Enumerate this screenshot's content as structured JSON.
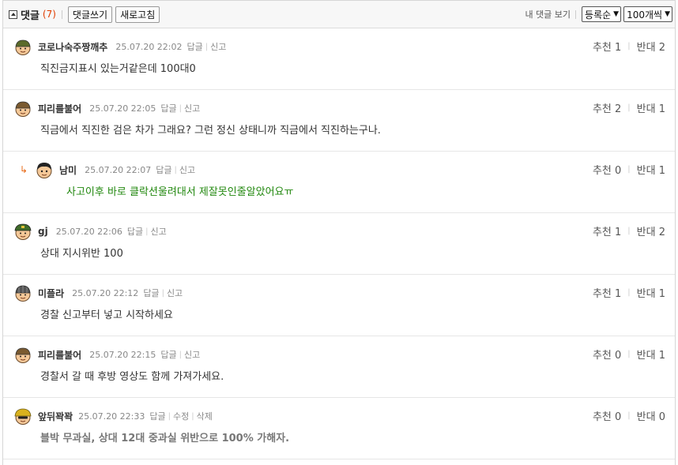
{
  "header": {
    "title": "댓글",
    "count": "(7)",
    "write_button": "댓글쓰기",
    "refresh_button": "새로고침",
    "my_comments_link": "내 댓글 보기",
    "sort_select": "등록순",
    "per_page_select": "100개씩"
  },
  "comments": [
    {
      "nick": "코로나숙주짱깨추",
      "date": "25.07.20 22:02",
      "act1": "답글",
      "act2": "신고",
      "text": "직진금지표시 있는거같은데 100대0",
      "up_label": "추천",
      "up": "1",
      "down_label": "반대",
      "down": "2"
    },
    {
      "nick": "피리를불어",
      "date": "25.07.20 22:05",
      "act1": "답글",
      "act2": "신고",
      "text": "직금에서 직진한 검은 차가 그래요? 그런 정신 상태니까 직금에서 직진하는구나.",
      "up_label": "추천",
      "up": "2",
      "down_label": "반대",
      "down": "1"
    },
    {
      "nick": "남미",
      "date": "25.07.20 22:07",
      "act1": "답글",
      "act2": "신고",
      "text": "사고이후 바로 클락션울려대서 제잘못인줄알았어요ㅠ",
      "up_label": "추천",
      "up": "0",
      "down_label": "반대",
      "down": "1",
      "reply_icon": "↳"
    },
    {
      "nick": "gj",
      "date": "25.07.20 22:06",
      "act1": "답글",
      "act2": "신고",
      "text": "상대 지시위반 100",
      "up_label": "추천",
      "up": "1",
      "down_label": "반대",
      "down": "2"
    },
    {
      "nick": "미플라",
      "date": "25.07.20 22:12",
      "act1": "답글",
      "act2": "신고",
      "text": "경찰 신고부터 넣고 시작하세요",
      "up_label": "추천",
      "up": "1",
      "down_label": "반대",
      "down": "1"
    },
    {
      "nick": "피리를불어",
      "date": "25.07.20 22:15",
      "act1": "답글",
      "act2": "신고",
      "text": "경찰서 갈 때 후방 영상도 함께 가져가세요.",
      "up_label": "추천",
      "up": "0",
      "down_label": "반대",
      "down": "1"
    },
    {
      "nick": "앞뒤꽉꽉",
      "date": "25.07.20 22:33",
      "act1": "답글",
      "act2": "수정",
      "act3": "삭제",
      "text": "블박 무과실, 상대 12대 중과실 위반으로 100% 가해자.",
      "up_label": "추천",
      "up": "0",
      "down_label": "반대",
      "down": "0"
    }
  ],
  "colors": {
    "count": "#e03c00",
    "reply_text": "#22880f",
    "reply_arrow": "#e86b1a"
  }
}
